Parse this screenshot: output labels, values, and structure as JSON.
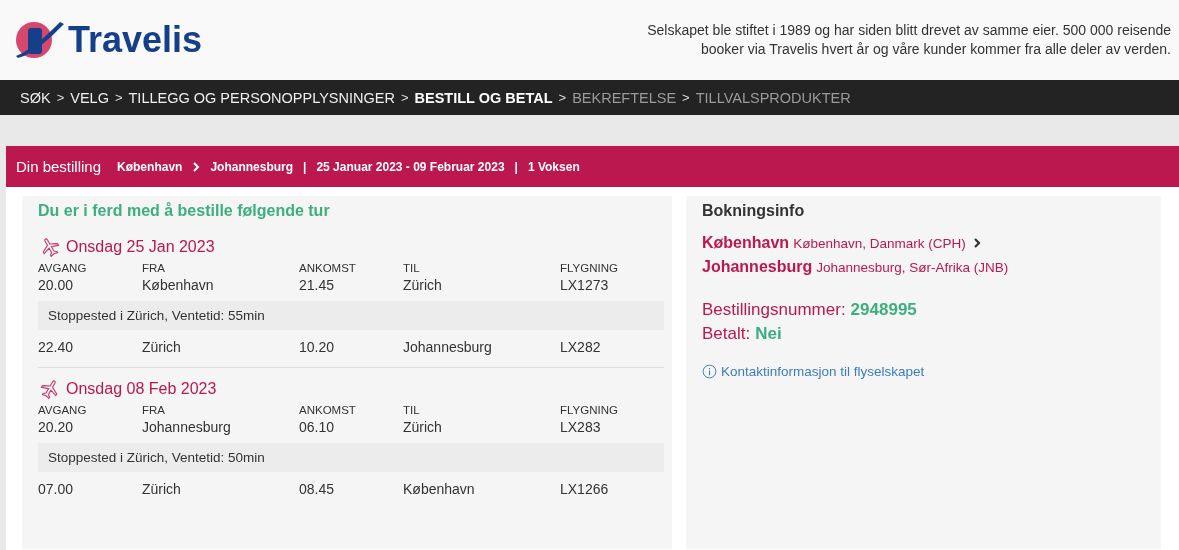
{
  "header": {
    "logo": "Travelis",
    "tagline": "Selskapet ble stiftet i 1989 og har siden blitt drevet av samme eier. 500 000 reisende booker via Travelis hvert år og våre kunder kommer fra alle deler av verden."
  },
  "steps": [
    {
      "label": "SØK",
      "selected": false,
      "disabled": false
    },
    {
      "label": "VELG",
      "selected": false,
      "disabled": false
    },
    {
      "label": "TILLEGG OG PERSONOPPLYSNINGER",
      "selected": false,
      "disabled": false
    },
    {
      "label": "BESTILL OG BETAL",
      "selected": true,
      "disabled": false
    },
    {
      "label": "BEKREFTELSE",
      "selected": false,
      "disabled": true
    },
    {
      "label": "TILLVALSPRODUKTER",
      "selected": false,
      "disabled": true
    }
  ],
  "step_separator": ">",
  "summary": {
    "title": "Din bestilling",
    "from": "København",
    "to": "Johannesburg",
    "dates": "25 Januar 2023 - 09 Februar 2023",
    "travellers": "1 Voksen",
    "separator": "|"
  },
  "trip": {
    "title": "Du er i ferd med å bestille følgende tur",
    "legs": [
      {
        "kind": "outbound",
        "date": "Onsdag 25 Jan 2023",
        "columns": [
          "AVGANG",
          "FRA",
          "ANKOMST",
          "TIL",
          "FLYGNING"
        ],
        "rows": [
          {
            "kind": "flight",
            "cells": [
              "20.00",
              "København",
              "21.45",
              "Zürich",
              "LX1273"
            ]
          },
          {
            "kind": "stop",
            "text": "Stoppested i Zürich, Ventetid: 55min"
          },
          {
            "kind": "flight",
            "cells": [
              "22.40",
              "Zürich",
              "10.20",
              "Johannesburg",
              "LX282"
            ]
          }
        ]
      },
      {
        "kind": "return",
        "date": "Onsdag 08 Feb 2023",
        "columns": [
          "AVGANG",
          "FRA",
          "ANKOMST",
          "TIL",
          "FLYGNING"
        ],
        "rows": [
          {
            "kind": "flight",
            "cells": [
              "20.20",
              "Johannesburg",
              "06.10",
              "Zürich",
              "LX283"
            ]
          },
          {
            "kind": "stop",
            "text": "Stoppested i Zürich, Ventetid: 50min"
          },
          {
            "kind": "flight",
            "cells": [
              "07.00",
              "Zürich",
              "08.45",
              "København",
              "LX1266"
            ]
          }
        ]
      }
    ]
  },
  "booking_info": {
    "title": "Bokningsinfo",
    "places": [
      {
        "city": "København",
        "detail": "København, Danmark (CPH)",
        "arrow": true
      },
      {
        "city": "Johannesburg",
        "detail": "Johannesburg, Sør-Afrika (JNB)",
        "arrow": false
      }
    ],
    "booking_number_label": "Bestillingsnummer:",
    "booking_number": "2948995",
    "paid_label": "Betalt:",
    "paid": "Nei",
    "contact_link": "Kontaktinformasjon til flyselskapet"
  }
}
